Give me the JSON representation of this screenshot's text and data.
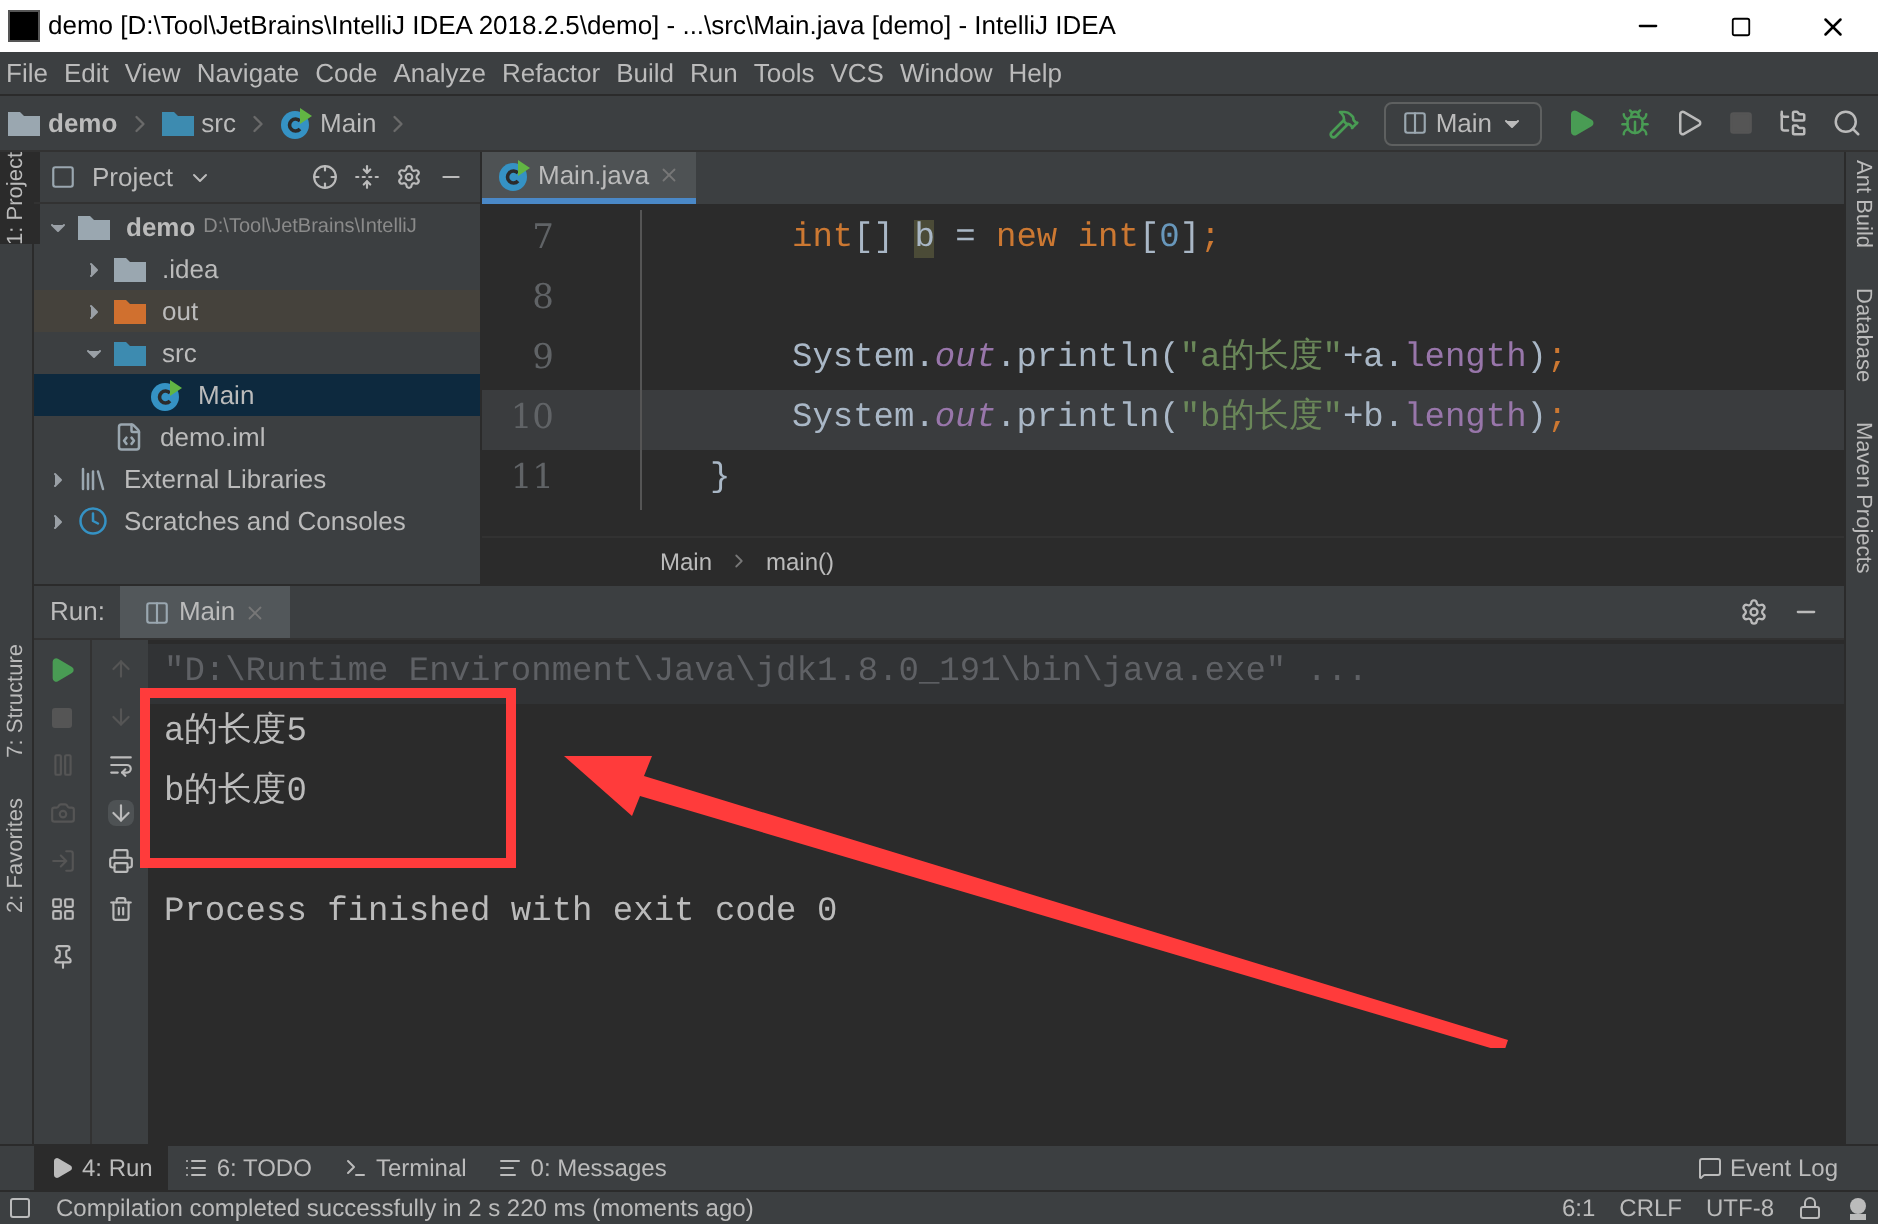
{
  "window": {
    "title": "demo [D:\\Tool\\JetBrains\\IntelliJ IDEA 2018.2.5\\demo] - ...\\src\\Main.java [demo] - IntelliJ IDEA"
  },
  "menu": [
    "File",
    "Edit",
    "View",
    "Navigate",
    "Code",
    "Analyze",
    "Refactor",
    "Build",
    "Run",
    "Tools",
    "VCS",
    "Window",
    "Help"
  ],
  "breadcrumb": [
    {
      "label": "demo",
      "kind": "module"
    },
    {
      "label": "src",
      "kind": "folder"
    },
    {
      "label": "Main",
      "kind": "class"
    }
  ],
  "run_config": "Main",
  "left_stripe": [
    "1: Project",
    "7: Structure",
    "2: Favorites"
  ],
  "right_stripe": [
    "Ant Build",
    "Database",
    "Maven Projects"
  ],
  "project_panel": {
    "title": "Project",
    "tree": [
      {
        "label": "demo",
        "path": "D:\\Tool\\JetBrains\\IntelliJ",
        "kind": "module",
        "expanded": true,
        "selected": false,
        "children": [
          {
            "label": ".idea",
            "kind": "folder",
            "expanded": false,
            "selected": false
          },
          {
            "label": "out",
            "kind": "excluded",
            "expanded": false,
            "selected": false
          },
          {
            "label": "src",
            "kind": "source",
            "expanded": true,
            "selected": false,
            "children": [
              {
                "label": "Main",
                "kind": "class",
                "selected": true
              }
            ]
          },
          {
            "label": "demo.iml",
            "kind": "file",
            "selected": false
          }
        ]
      },
      {
        "label": "External Libraries",
        "kind": "libraries",
        "expanded": false,
        "selected": false
      },
      {
        "label": "Scratches and Consoles",
        "kind": "scratches",
        "expanded": false,
        "selected": false
      }
    ]
  },
  "editor": {
    "tabs": [
      {
        "label": "Main.java",
        "selected": true
      }
    ],
    "lines": [
      {
        "number": "7",
        "current": false,
        "kind": "statement",
        "tokens": [
          {
            "kind": "keyword",
            "text": "int"
          },
          {
            "kind": "plain",
            "text": "[] "
          },
          {
            "kind": "highlight",
            "text": "b"
          },
          {
            "kind": "plain",
            "text": " = "
          },
          {
            "kind": "keyword",
            "text": "new int"
          },
          {
            "kind": "plain",
            "text": "["
          },
          {
            "kind": "number",
            "text": "0"
          },
          {
            "kind": "plain",
            "text": "]"
          },
          {
            "kind": "keyword",
            "text": ";"
          }
        ]
      },
      {
        "number": "8",
        "current": false
      },
      {
        "number": "9",
        "current": false,
        "kind": "statement",
        "tokens": [
          {
            "kind": "plain",
            "text": "System."
          },
          {
            "kind": "static",
            "text": "out"
          },
          {
            "kind": "plain",
            "text": ".println("
          },
          {
            "kind": "string",
            "text": "\"a的长度\""
          },
          {
            "kind": "plain",
            "text": "+a."
          },
          {
            "kind": "field",
            "text": "length"
          },
          {
            "kind": "plain",
            "text": ")"
          },
          {
            "kind": "keyword",
            "text": ";"
          }
        ]
      },
      {
        "number": "10",
        "current": true,
        "kind": "statement",
        "tokens": [
          {
            "kind": "plain",
            "text": "System."
          },
          {
            "kind": "static",
            "text": "out"
          },
          {
            "kind": "plain",
            "text": ".println("
          },
          {
            "kind": "string",
            "text": "\"b的长度\""
          },
          {
            "kind": "plain",
            "text": "+b."
          },
          {
            "kind": "field",
            "text": "length"
          },
          {
            "kind": "plain",
            "text": ")"
          },
          {
            "kind": "keyword",
            "text": ";"
          }
        ]
      },
      {
        "number": "11",
        "current": false,
        "kind": "block",
        "tokens": [
          {
            "kind": "plain",
            "text": "}"
          }
        ]
      }
    ],
    "breadcrumb": [
      "Main",
      "main()"
    ]
  },
  "run_panel": {
    "label": "Run:",
    "tabs": [
      {
        "label": "Main",
        "selected": true
      }
    ],
    "console": [
      {
        "kind": "command",
        "text": "\"D:\\Runtime Environment\\Java\\jdk1.8.0_191\\bin\\java.exe\" ..."
      },
      {
        "kind": "output",
        "text": "a的长度5"
      },
      {
        "kind": "output",
        "text": "b的长度0"
      },
      {
        "kind": "blank"
      },
      {
        "kind": "output",
        "text": "Process finished with exit code 0"
      }
    ]
  },
  "bottom_tabs": [
    {
      "label": "4: Run",
      "kind": "run",
      "selected": true
    },
    {
      "label": "6: TODO",
      "kind": "todo",
      "selected": false
    },
    {
      "label": "Terminal",
      "kind": "terminal",
      "selected": false
    },
    {
      "label": "0: Messages",
      "kind": "messages",
      "selected": false
    }
  ],
  "event_log": "Event Log",
  "status_bar": {
    "message": "Compilation completed successfully in 2 s 220 ms (moments ago)",
    "position": "6:1",
    "line_separator": "CRLF",
    "encoding": "UTF-8"
  }
}
